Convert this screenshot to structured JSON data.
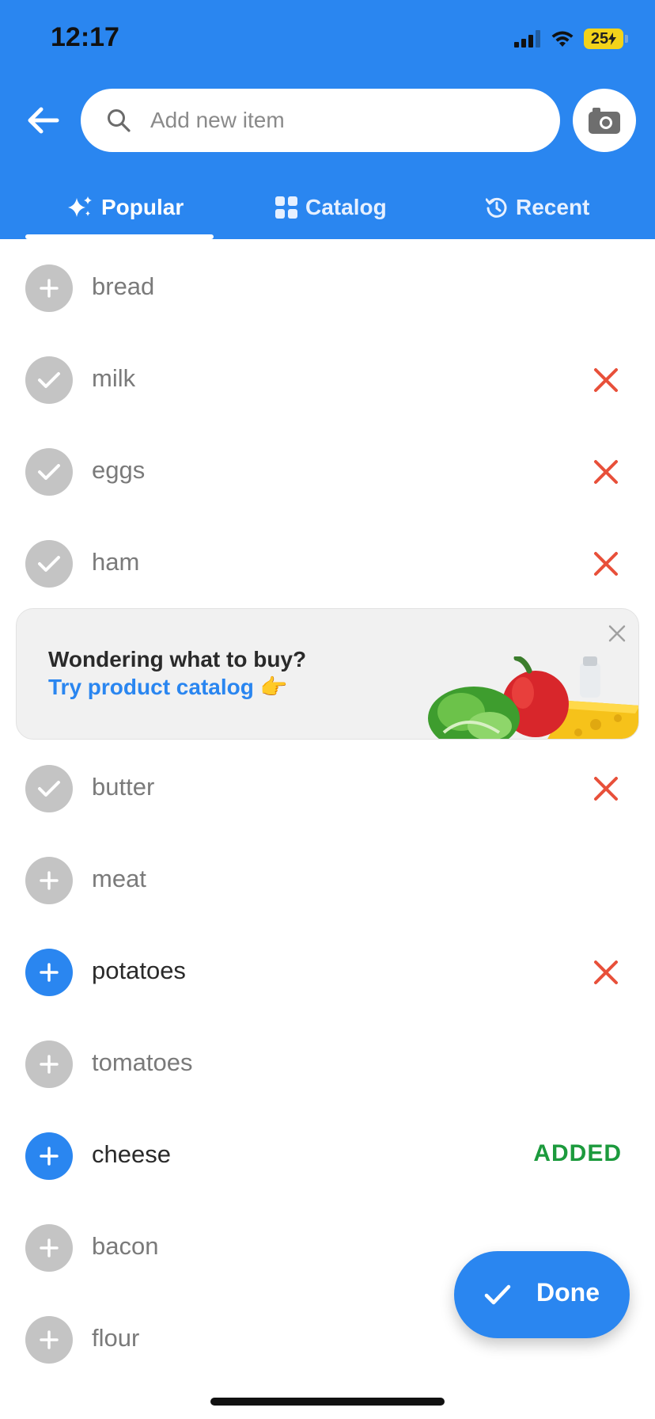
{
  "status_bar": {
    "time": "12:17",
    "battery": "25"
  },
  "search": {
    "placeholder": "Add new item"
  },
  "tabs": [
    {
      "label": "Popular",
      "icon": "sparkle-icon",
      "active": true
    },
    {
      "label": "Catalog",
      "icon": "grid-icon",
      "active": false
    },
    {
      "label": "Recent",
      "icon": "history-icon",
      "active": false
    }
  ],
  "items": [
    {
      "label": "bread",
      "state": "plus"
    },
    {
      "label": "milk",
      "state": "checked",
      "removable": true
    },
    {
      "label": "eggs",
      "state": "checked",
      "removable": true
    },
    {
      "label": "ham",
      "state": "checked",
      "removable": true
    },
    {
      "label": "butter",
      "state": "checked",
      "removable": true
    },
    {
      "label": "meat",
      "state": "plus"
    },
    {
      "label": "potatoes",
      "state": "added",
      "removable": true
    },
    {
      "label": "tomatoes",
      "state": "plus"
    },
    {
      "label": "cheese",
      "state": "added",
      "badge": "ADDED"
    },
    {
      "label": "bacon",
      "state": "plus"
    },
    {
      "label": "flour",
      "state": "plus"
    }
  ],
  "promo": {
    "title": "Wondering what to buy?",
    "link": "Try product catalog 👉"
  },
  "done_button": {
    "label": "Done"
  },
  "colors": {
    "primary": "#2a86f0",
    "remove": "#e8503a",
    "added": "#1c9a3d",
    "inactive": "#c4c4c4"
  }
}
